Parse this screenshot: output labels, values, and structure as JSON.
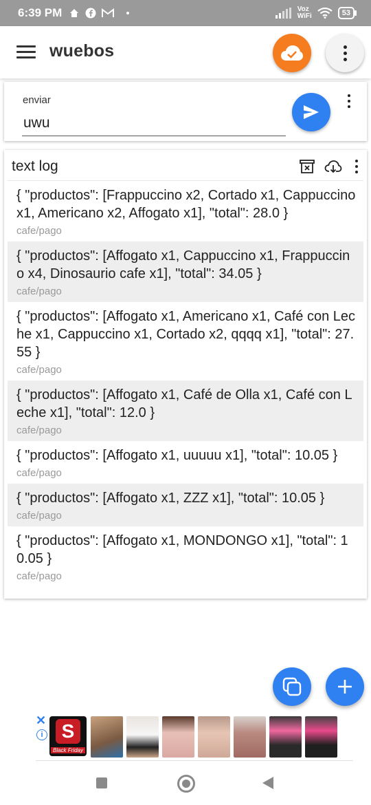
{
  "status_bar": {
    "time": "6:39 PM",
    "network_label_top": "Voz",
    "network_label_bottom": "WiFi",
    "battery": "53"
  },
  "app_bar": {
    "title": "wuebos",
    "menu_icon": "menu-icon",
    "cloud_icon": "cloud-check-icon",
    "cloud_color": "#f57c1f",
    "more_icon": "more-vert-icon"
  },
  "send": {
    "label": "enviar",
    "value": "uwu",
    "button_icon": "send-icon",
    "button_color": "#2f80f0"
  },
  "log": {
    "title": "text log",
    "clear_icon": "clear-archive-icon",
    "download_icon": "cloud-download-icon",
    "entries": [
      {
        "message": "{ \"productos\": [Frappuccino x2, Cortado x1, Cappuccino x1, Americano x2, Affogato x1], \"total\": 28.0 }",
        "topic": "cafe/pago"
      },
      {
        "message": "{ \"productos\": [Affogato x1, Cappuccino x1, Frappuccino x4, Dinosaurio cafe x1], \"total\": 34.05 }",
        "topic": "cafe/pago"
      },
      {
        "message": "{ \"productos\": [Affogato x1, Americano x1, Café con Leche x1, Cappuccino x1, Cortado x2, qqqq x1], \"total\": 27.55 }",
        "topic": "cafe/pago"
      },
      {
        "message": "{ \"productos\": [Affogato x1, Café de Olla x1, Café con Leche x1], \"total\": 12.0 }",
        "topic": "cafe/pago"
      },
      {
        "message": "{ \"productos\": [Affogato x1, uuuuu x1], \"total\": 10.05 }",
        "topic": "cafe/pago"
      },
      {
        "message": "{ \"productos\": [Affogato x1, ZZZ x1], \"total\": 10.05 }",
        "topic": "cafe/pago"
      },
      {
        "message": "{ \"productos\": [Affogato x1, MONDONGO x1], \"total\": 10.05 }",
        "topic": "cafe/pago"
      }
    ]
  },
  "fabs": {
    "copy_icon": "copy-icon",
    "add_icon": "add-icon"
  },
  "ad": {
    "logo_letter": "S",
    "logo_caption": "Black Friday",
    "close_icon": "close-icon",
    "info_icon": "info-icon"
  },
  "nav": {
    "recents_icon": "recents-icon",
    "home_icon": "home-icon",
    "back_icon": "back-icon"
  }
}
